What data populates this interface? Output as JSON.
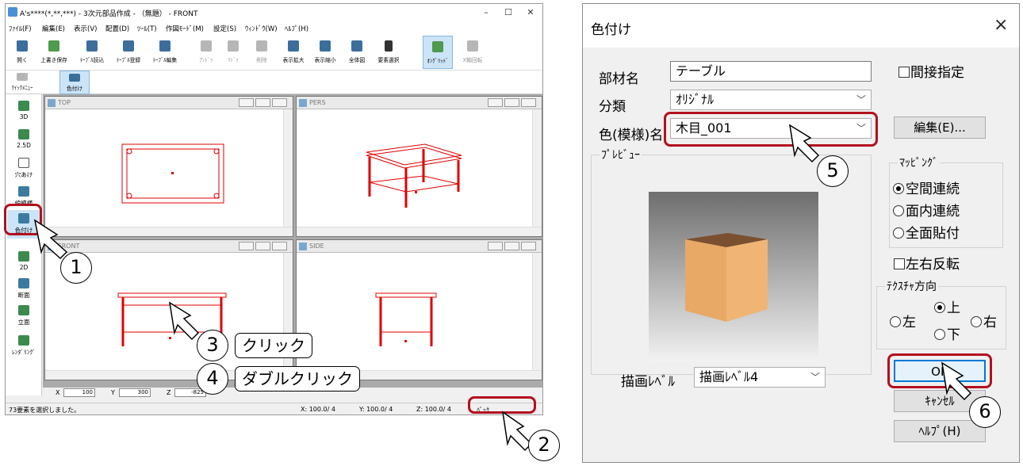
{
  "main_window": {
    "title": "A's****(*,**,***) - 3次元部品作成 - （無題） - FRONT",
    "menu": [
      "ﾌｧｲﾙ(F)",
      "編集(E)",
      "表示(V)",
      "配置(D)",
      "ﾂｰﾙ(T)",
      "作図ﾓｰﾄﾞ(M)",
      "設定(S)",
      "ｳｨﾝﾄﾞｳ(W)",
      "ﾍﾙﾌﾟ(H)"
    ],
    "toolbar": [
      "開く",
      "上書き保存",
      "ﾃｰﾌﾞﾙ読込",
      "ﾃｰﾌﾞﾙ登録",
      "ﾃｰﾌﾞﾙ編集",
      "ｱﾝﾄﾞｩ",
      "ﾘﾄﾞｩ",
      "削除",
      "表示拡大",
      "表示縮小",
      "全体図",
      "要素選択",
      "ｵﾝｸﾞﾘｯﾄﾞ",
      "X軸回転"
    ],
    "toolbar2": [
      "ｸｲｯｸﾒﾆｭｰ",
      "色付け"
    ],
    "left_tools": [
      "3D",
      "2.5D",
      "穴あけ",
      "線模様",
      "色付け",
      "2D",
      "断面",
      "立面",
      "ﾚﾝﾀﾞﾘﾝｸﾞ"
    ],
    "viewports": [
      "TOP",
      "PERS",
      "FRONT",
      "SIDE"
    ],
    "coords": {
      "x_label": "X",
      "x_value": "100",
      "y_label": "Y",
      "y_value": "300",
      "z_label": "Z",
      "z_value": "-825"
    },
    "status": {
      "message": "73要素を選択しました。",
      "x": "X: 100.0/ 4",
      "y": "Y: 100.0/ 4",
      "z": "Z: 100.0/ 4",
      "back": "ﾊﾞｯｸ"
    }
  },
  "dialog": {
    "title": "色付け",
    "close": "×",
    "part_name_label": "部材名",
    "part_name_value": "テーブル",
    "indirect_label": "間接指定",
    "category_label": "分類",
    "category_value": "ｵﾘｼﾞﾅﾙ",
    "color_label": "色(模様)名",
    "color_value": "木目_001",
    "edit_button": "編集(E)...",
    "preview_label": "ﾌﾟﾚﾋﾞｭｰ",
    "mapping_label": "ﾏｯﾋﾟﾝｸﾞ",
    "mapping_options": [
      "空間連続",
      "面内連続",
      "全面貼付"
    ],
    "mapping_selected": 0,
    "flip_label": "左右反転",
    "texture_dir_label": "ﾃｸｽﾁｬ方向",
    "dir_left": "左",
    "dir_up": "上",
    "dir_right": "右",
    "dir_down": "下",
    "dir_selected": "上",
    "draw_level_label": "描画ﾚﾍﾞﾙ",
    "draw_level_value": "描画ﾚﾍﾞﾙ4",
    "ok_button": "OK",
    "cancel_button": "ｷｬﾝｾﾙ",
    "help_button": "ﾍﾙﾌﾟ(H)"
  },
  "callouts": {
    "n1": "1",
    "n2": "2",
    "n3": "3",
    "n4": "4",
    "n5": "5",
    "n6": "6",
    "click": "クリック",
    "double_click": "ダブルクリック"
  },
  "colors": {
    "highlight": "#b30f1e",
    "drawing": "#e00000",
    "wood": "#e8a866"
  }
}
